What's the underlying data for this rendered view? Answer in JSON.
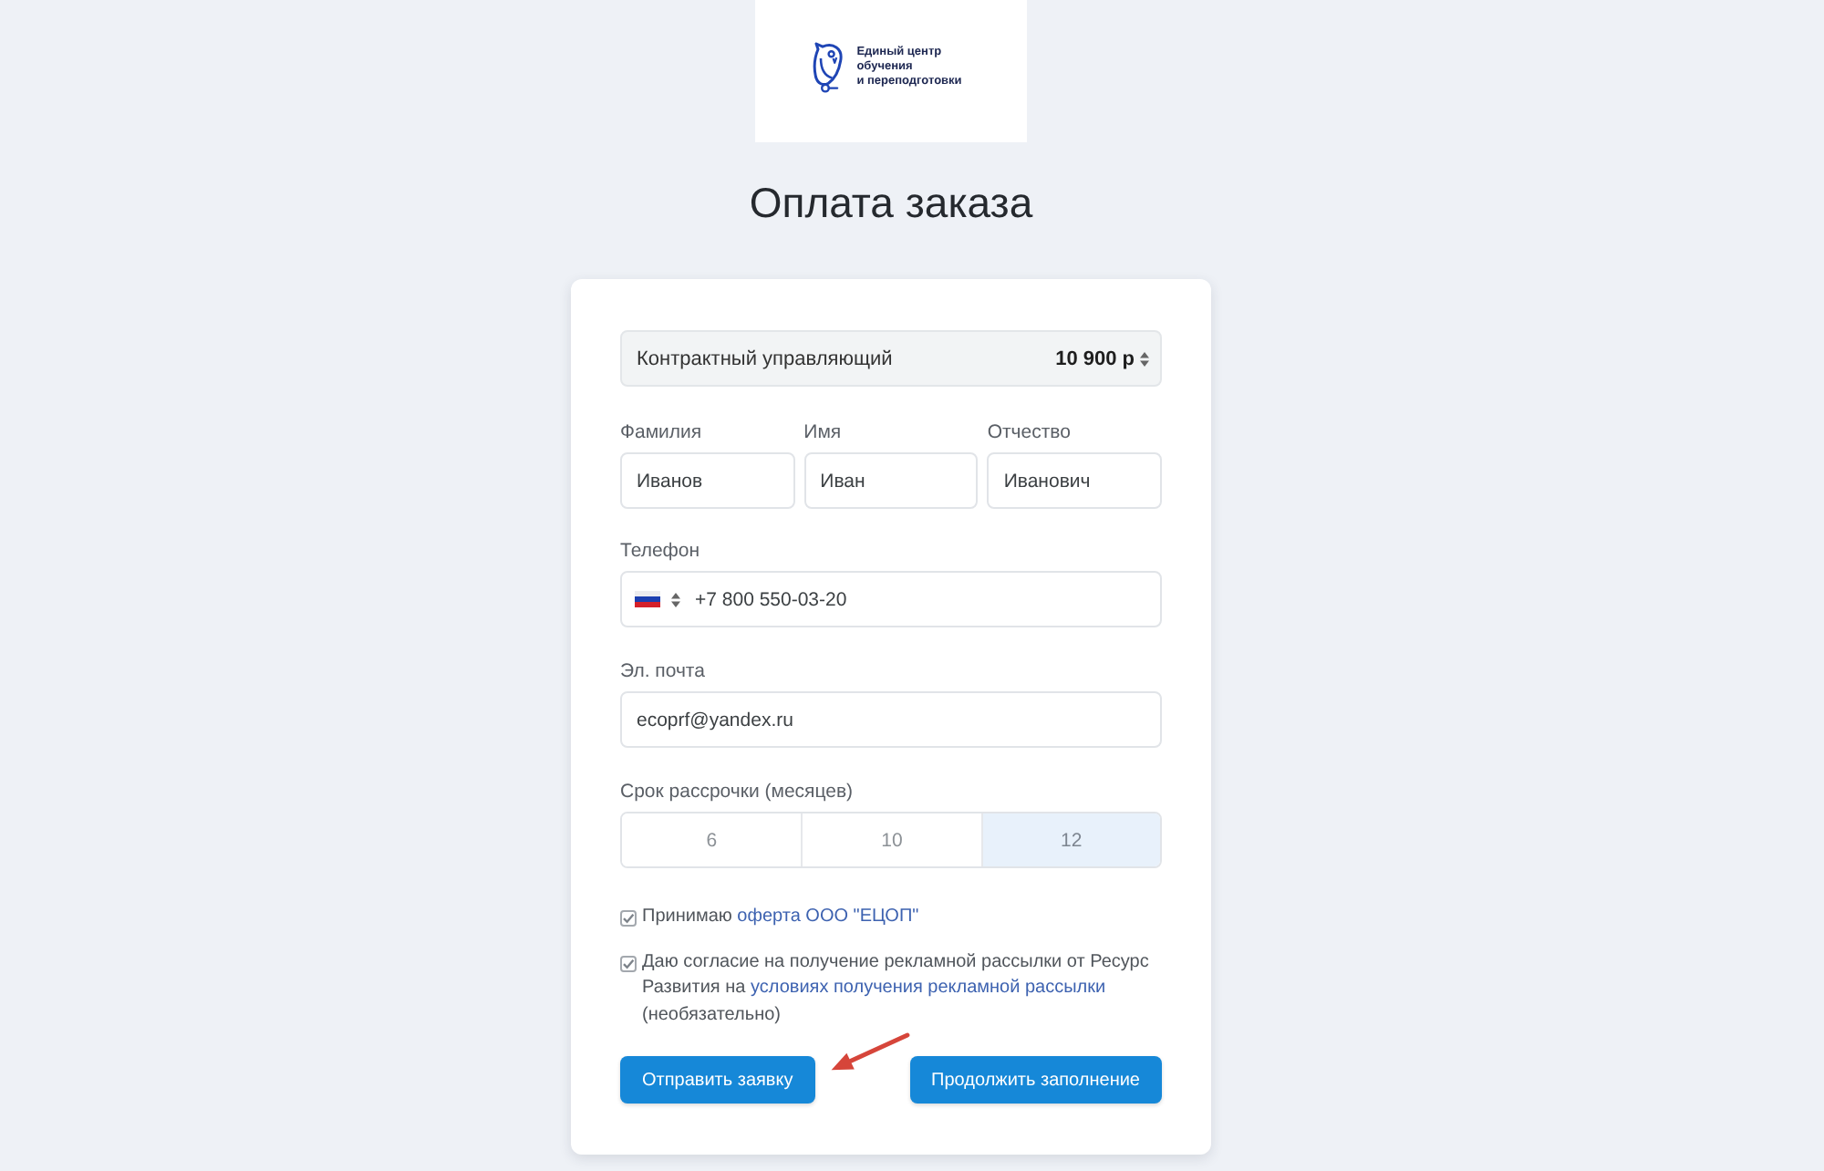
{
  "logo": {
    "text_lines": [
      "Единый центр",
      "обучения",
      "и переподготовки"
    ]
  },
  "title": "Оплата заказа",
  "course_select": {
    "value": "Контрактный управляющий",
    "price": "10 900 р"
  },
  "name_fields": [
    {
      "label": "Фамилия",
      "value": "Иванов"
    },
    {
      "label": "Имя",
      "value": "Иван"
    },
    {
      "label": "Отчество",
      "value": "Иванович"
    }
  ],
  "phone": {
    "label": "Телефон",
    "value": "+7 800 550-03-20"
  },
  "email": {
    "label": "Эл. почта",
    "value": "ecoprf@yandex.ru"
  },
  "installment": {
    "label": "Срок рассрочки (месяцев)",
    "options": [
      {
        "label": "6",
        "selected": false
      },
      {
        "label": "10",
        "selected": false
      },
      {
        "label": "12",
        "selected": true
      }
    ]
  },
  "consents": [
    {
      "checked": true,
      "text": "Принимаю",
      "link": "оферта ООО \"ЕЦОП\""
    },
    {
      "checked": true,
      "text": "Даю согласие на получение рекламной рассылки от Ресурс Развития на",
      "link": "условиях получения рекламной рассылки",
      "suffix": "(необязательно)"
    }
  ],
  "buttons": [
    {
      "label": "Отправить заявку"
    },
    {
      "label": "Продолжить заполнение"
    }
  ],
  "annotation": {
    "kind": "arrow"
  }
}
